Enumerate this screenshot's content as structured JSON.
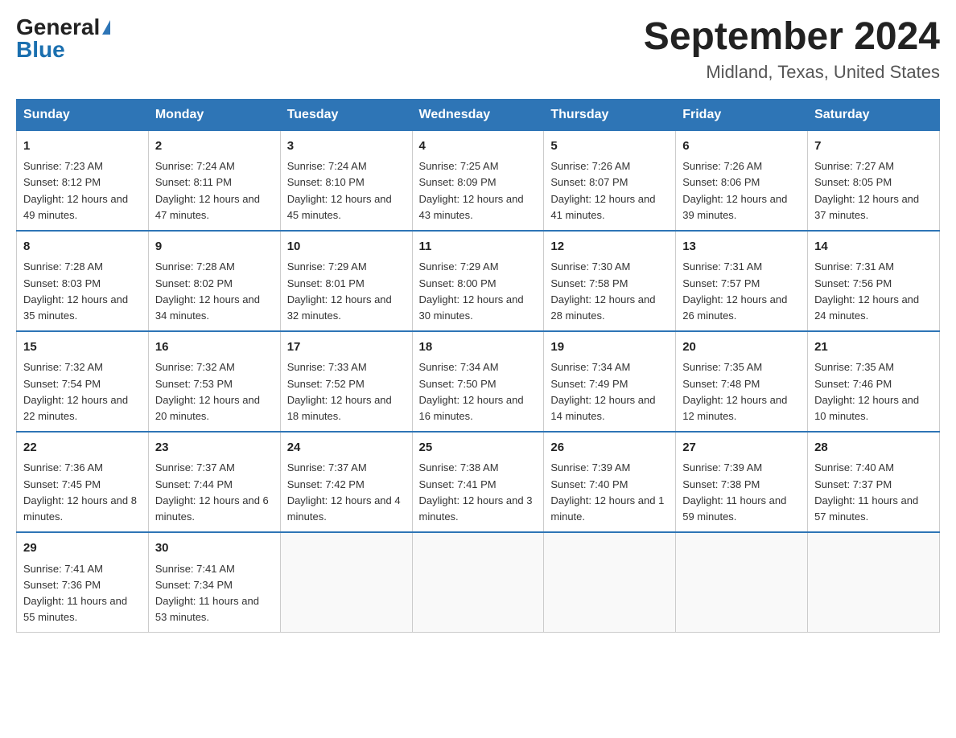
{
  "header": {
    "logo_general": "General",
    "logo_blue": "Blue",
    "title": "September 2024",
    "subtitle": "Midland, Texas, United States"
  },
  "weekdays": [
    "Sunday",
    "Monday",
    "Tuesday",
    "Wednesday",
    "Thursday",
    "Friday",
    "Saturday"
  ],
  "weeks": [
    [
      {
        "day": "1",
        "sunrise": "7:23 AM",
        "sunset": "8:12 PM",
        "daylight": "12 hours and 49 minutes."
      },
      {
        "day": "2",
        "sunrise": "7:24 AM",
        "sunset": "8:11 PM",
        "daylight": "12 hours and 47 minutes."
      },
      {
        "day": "3",
        "sunrise": "7:24 AM",
        "sunset": "8:10 PM",
        "daylight": "12 hours and 45 minutes."
      },
      {
        "day": "4",
        "sunrise": "7:25 AM",
        "sunset": "8:09 PM",
        "daylight": "12 hours and 43 minutes."
      },
      {
        "day": "5",
        "sunrise": "7:26 AM",
        "sunset": "8:07 PM",
        "daylight": "12 hours and 41 minutes."
      },
      {
        "day": "6",
        "sunrise": "7:26 AM",
        "sunset": "8:06 PM",
        "daylight": "12 hours and 39 minutes."
      },
      {
        "day": "7",
        "sunrise": "7:27 AM",
        "sunset": "8:05 PM",
        "daylight": "12 hours and 37 minutes."
      }
    ],
    [
      {
        "day": "8",
        "sunrise": "7:28 AM",
        "sunset": "8:03 PM",
        "daylight": "12 hours and 35 minutes."
      },
      {
        "day": "9",
        "sunrise": "7:28 AM",
        "sunset": "8:02 PM",
        "daylight": "12 hours and 34 minutes."
      },
      {
        "day": "10",
        "sunrise": "7:29 AM",
        "sunset": "8:01 PM",
        "daylight": "12 hours and 32 minutes."
      },
      {
        "day": "11",
        "sunrise": "7:29 AM",
        "sunset": "8:00 PM",
        "daylight": "12 hours and 30 minutes."
      },
      {
        "day": "12",
        "sunrise": "7:30 AM",
        "sunset": "7:58 PM",
        "daylight": "12 hours and 28 minutes."
      },
      {
        "day": "13",
        "sunrise": "7:31 AM",
        "sunset": "7:57 PM",
        "daylight": "12 hours and 26 minutes."
      },
      {
        "day": "14",
        "sunrise": "7:31 AM",
        "sunset": "7:56 PM",
        "daylight": "12 hours and 24 minutes."
      }
    ],
    [
      {
        "day": "15",
        "sunrise": "7:32 AM",
        "sunset": "7:54 PM",
        "daylight": "12 hours and 22 minutes."
      },
      {
        "day": "16",
        "sunrise": "7:32 AM",
        "sunset": "7:53 PM",
        "daylight": "12 hours and 20 minutes."
      },
      {
        "day": "17",
        "sunrise": "7:33 AM",
        "sunset": "7:52 PM",
        "daylight": "12 hours and 18 minutes."
      },
      {
        "day": "18",
        "sunrise": "7:34 AM",
        "sunset": "7:50 PM",
        "daylight": "12 hours and 16 minutes."
      },
      {
        "day": "19",
        "sunrise": "7:34 AM",
        "sunset": "7:49 PM",
        "daylight": "12 hours and 14 minutes."
      },
      {
        "day": "20",
        "sunrise": "7:35 AM",
        "sunset": "7:48 PM",
        "daylight": "12 hours and 12 minutes."
      },
      {
        "day": "21",
        "sunrise": "7:35 AM",
        "sunset": "7:46 PM",
        "daylight": "12 hours and 10 minutes."
      }
    ],
    [
      {
        "day": "22",
        "sunrise": "7:36 AM",
        "sunset": "7:45 PM",
        "daylight": "12 hours and 8 minutes."
      },
      {
        "day": "23",
        "sunrise": "7:37 AM",
        "sunset": "7:44 PM",
        "daylight": "12 hours and 6 minutes."
      },
      {
        "day": "24",
        "sunrise": "7:37 AM",
        "sunset": "7:42 PM",
        "daylight": "12 hours and 4 minutes."
      },
      {
        "day": "25",
        "sunrise": "7:38 AM",
        "sunset": "7:41 PM",
        "daylight": "12 hours and 3 minutes."
      },
      {
        "day": "26",
        "sunrise": "7:39 AM",
        "sunset": "7:40 PM",
        "daylight": "12 hours and 1 minute."
      },
      {
        "day": "27",
        "sunrise": "7:39 AM",
        "sunset": "7:38 PM",
        "daylight": "11 hours and 59 minutes."
      },
      {
        "day": "28",
        "sunrise": "7:40 AM",
        "sunset": "7:37 PM",
        "daylight": "11 hours and 57 minutes."
      }
    ],
    [
      {
        "day": "29",
        "sunrise": "7:41 AM",
        "sunset": "7:36 PM",
        "daylight": "11 hours and 55 minutes."
      },
      {
        "day": "30",
        "sunrise": "7:41 AM",
        "sunset": "7:34 PM",
        "daylight": "11 hours and 53 minutes."
      },
      null,
      null,
      null,
      null,
      null
    ]
  ]
}
